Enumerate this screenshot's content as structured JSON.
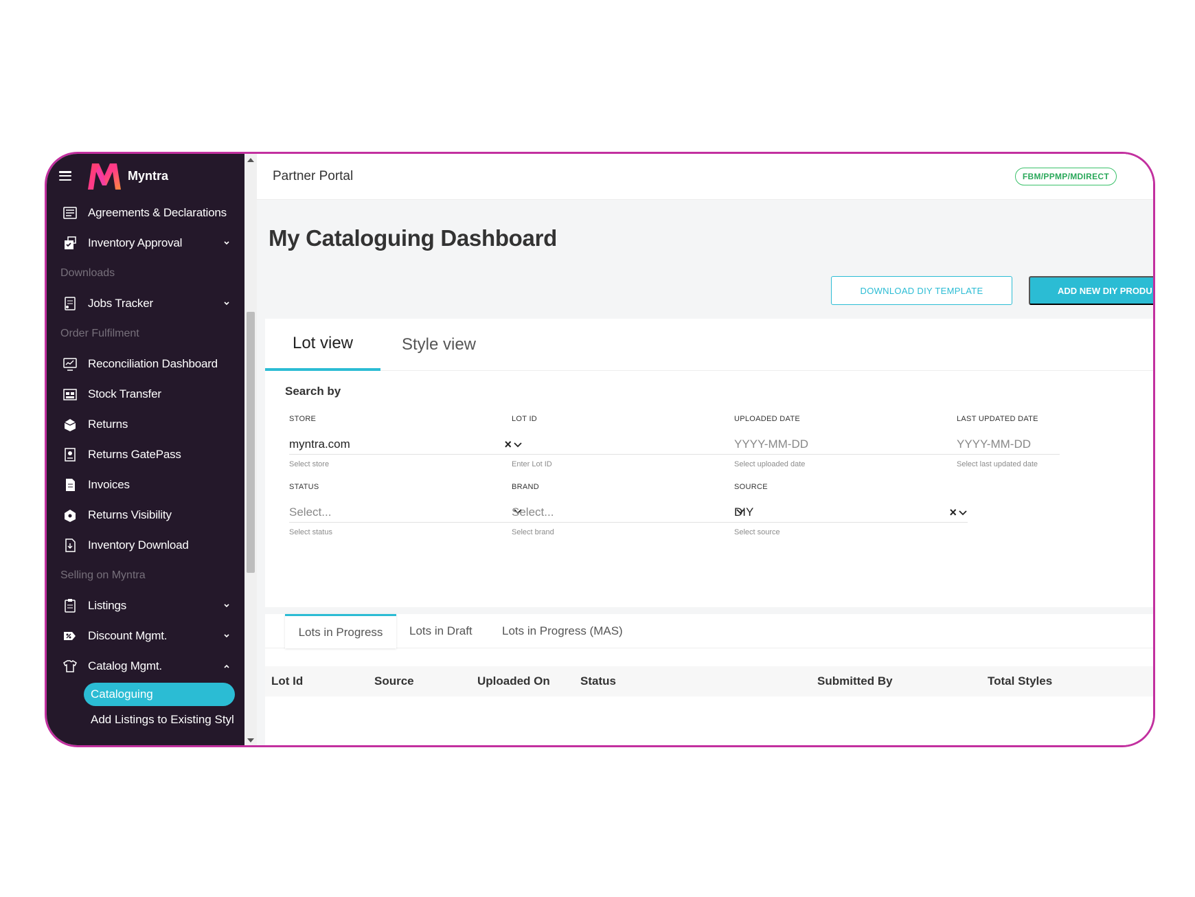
{
  "app": {
    "brand": "Myntra",
    "portal_title": "Partner Portal",
    "badge": "FBM/PPMP/MDIRECT"
  },
  "sidebar": {
    "items": [
      {
        "type": "item",
        "label": "Agreements & Declarations",
        "icon": "document-list-icon",
        "chevron": ""
      },
      {
        "type": "item",
        "label": "Inventory Approval",
        "icon": "box-check-icon",
        "chevron": "down"
      },
      {
        "type": "section",
        "label": "Downloads"
      },
      {
        "type": "item",
        "label": "Jobs Tracker",
        "icon": "tracker-icon",
        "chevron": "down"
      },
      {
        "type": "section",
        "label": "Order Fulfilment"
      },
      {
        "type": "item",
        "label": "Reconciliation Dashboard",
        "icon": "dashboard-icon",
        "chevron": ""
      },
      {
        "type": "item",
        "label": "Stock Transfer",
        "icon": "warehouse-icon",
        "chevron": ""
      },
      {
        "type": "item",
        "label": "Returns",
        "icon": "returns-box-icon",
        "chevron": ""
      },
      {
        "type": "item",
        "label": "Returns GatePass",
        "icon": "gatepass-icon",
        "chevron": ""
      },
      {
        "type": "item",
        "label": "Invoices",
        "icon": "invoice-icon",
        "chevron": ""
      },
      {
        "type": "item",
        "label": "Returns Visibility",
        "icon": "returns-visibility-icon",
        "chevron": ""
      },
      {
        "type": "item",
        "label": "Inventory Download",
        "icon": "download-file-icon",
        "chevron": ""
      },
      {
        "type": "section",
        "label": "Selling on Myntra"
      },
      {
        "type": "item",
        "label": "Listings",
        "icon": "clipboard-icon",
        "chevron": "down"
      },
      {
        "type": "item",
        "label": "Discount Mgmt.",
        "icon": "discount-icon",
        "chevron": "down"
      },
      {
        "type": "item",
        "label": "Catalog Mgmt.",
        "icon": "tshirt-icon",
        "chevron": "up"
      }
    ],
    "active_sub": "Cataloguing",
    "sub_items": [
      "Add Listings to Existing Styl"
    ]
  },
  "header": {
    "title": "My Cataloguing Dashboard",
    "download_button": "DOWNLOAD DIY TEMPLATE",
    "add_button": "ADD NEW DIY PRODU"
  },
  "tabs": [
    "Lot view",
    "Style view"
  ],
  "search": {
    "heading": "Search by",
    "fields": [
      {
        "label": "STORE",
        "value": "myntra.com",
        "placeholder": "",
        "help": "Select store",
        "controls": "clear-select"
      },
      {
        "label": "LOT ID",
        "value": "",
        "placeholder": "",
        "help": "Enter Lot ID",
        "controls": ""
      },
      {
        "label": "UPLOADED DATE",
        "value": "",
        "placeholder": "YYYY-MM-DD",
        "help": "Select uploaded date",
        "controls": ""
      },
      {
        "label": "LAST UPDATED DATE",
        "value": "",
        "placeholder": "YYYY-MM-DD",
        "help": "Select last updated date",
        "controls": ""
      },
      {
        "label": "STATUS",
        "value": "",
        "placeholder": "Select...",
        "help": "Select status",
        "controls": "select"
      },
      {
        "label": "BRAND",
        "value": "",
        "placeholder": "Select...",
        "help": "Select brand",
        "controls": "select"
      },
      {
        "label": "SOURCE",
        "value": "DIY",
        "placeholder": "",
        "help": "Select source",
        "controls": "clear-select"
      }
    ]
  },
  "lot_tabs": [
    "Lots in Progress",
    "Lots in Draft",
    "Lots in Progress (MAS)"
  ],
  "table": {
    "columns": [
      "Lot Id",
      "Source",
      "Uploaded On",
      "Status",
      "Submitted By",
      "Total Styles"
    ]
  },
  "colors": {
    "accent": "#2bbcd4",
    "sidebar_bg": "#24182a",
    "frame_border": "#c2309f",
    "badge_green": "#2aa85a"
  }
}
